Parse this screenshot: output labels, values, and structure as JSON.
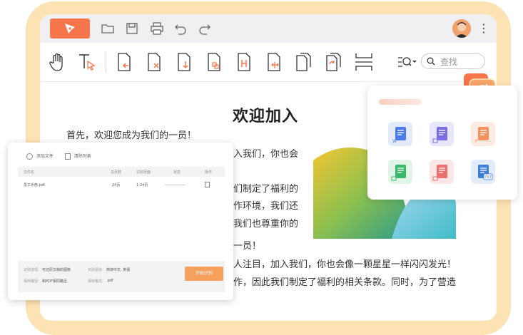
{
  "search": {
    "placeholder": "查找"
  },
  "document": {
    "title": "欢迎加入",
    "lines": [
      "首先，欢迎您成为我们的一员！",
      "入我们，你也会",
      "们制定了福利的",
      "作环境，我们还",
      "我们也尊重你的",
      "一员！",
      "人注目，加入我们，你也会像一颗星星一样闪闪发光！",
      "作，因此我们制定了福利的相关条款。同时，为了营造"
    ]
  },
  "dialog": {
    "add_file": "添加文件",
    "clear_list": "清除列表",
    "columns": [
      "文件名",
      "总页数",
      "识别页面",
      "状态",
      "操作"
    ],
    "row": {
      "name": "员工手册.pdf",
      "pages": "24页",
      "range": "1-24页"
    },
    "footer": {
      "mode_label": "识别选项:",
      "mode_value": "可还原文档的图像",
      "lang_label": "识别语言:",
      "lang_value": "简体中文, 英语",
      "save_label": "保存路径:",
      "save_value": "和PDF相同路径",
      "format_label": "保存格式:",
      "format_value": ".pdf"
    },
    "start_button": "开始识别"
  },
  "colors": {
    "accent": "#f7754a",
    "frame": "#fde3b3",
    "word": "#4a7be8",
    "image": "#7a6fe0",
    "ppt": "#f2925f",
    "excel": "#39b86a",
    "pdf_img": "#ef6e6e",
    "txt": "#3d7ed8"
  }
}
